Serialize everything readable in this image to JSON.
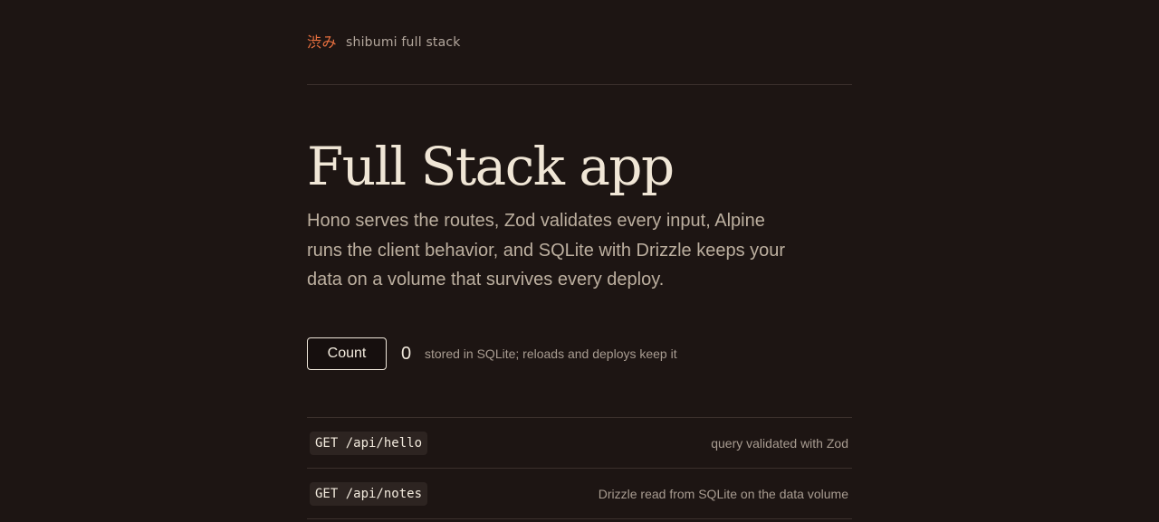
{
  "header": {
    "brand_mark": "渋み",
    "brand_name": "shibumi full stack"
  },
  "hero": {
    "title": "Full Stack app",
    "lead": "Hono serves the routes, Zod validates every input, Alpine runs the client behavior, and SQLite with Drizzle keeps your data on a volume that survives every deploy."
  },
  "counter": {
    "button_label": "Count",
    "value": "0",
    "note": "stored in SQLite; reloads and deploys keep it"
  },
  "routes": [
    {
      "code": "GET /api/hello",
      "description": "query validated with Zod"
    },
    {
      "code": "GET /api/notes",
      "description": "Drizzle read from SQLite on the data volume"
    }
  ],
  "colors": {
    "background": "#1d1513",
    "accent": "#e8703f",
    "text": "#efe7da",
    "muted": "#a89c91"
  }
}
